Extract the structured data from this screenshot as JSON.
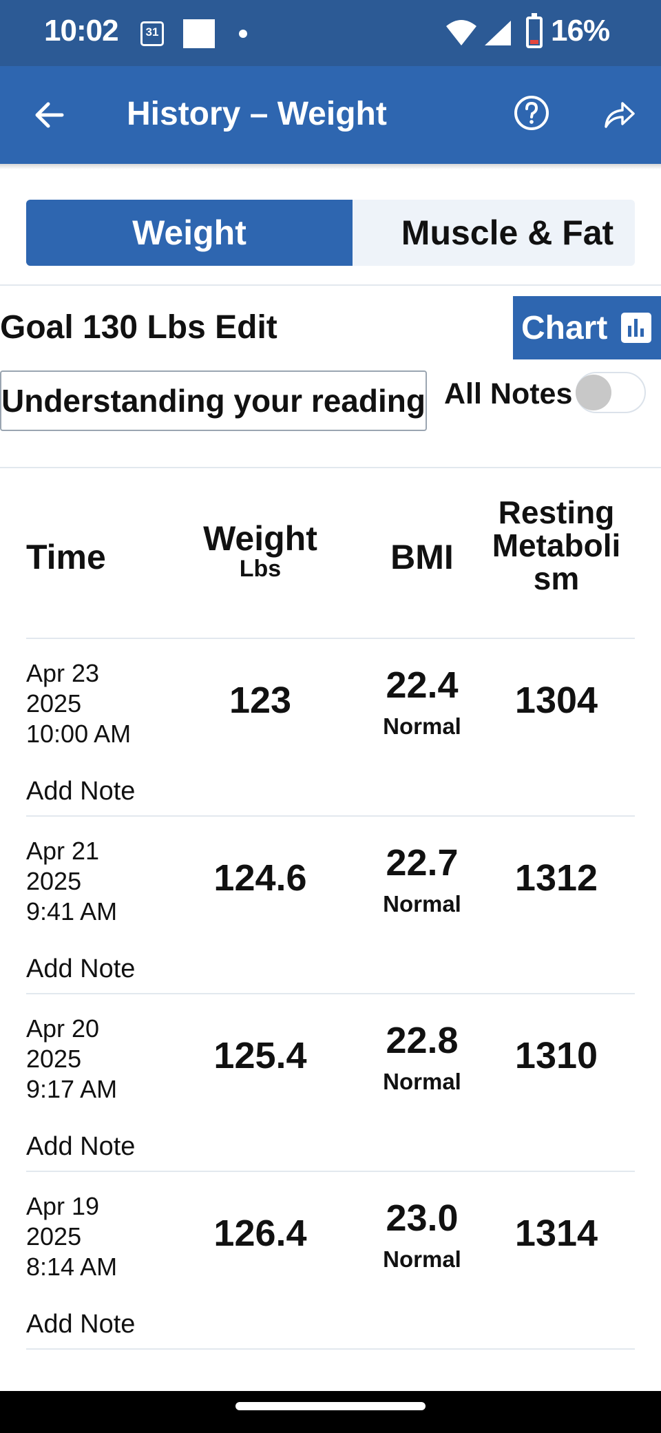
{
  "status_bar": {
    "time": "10:02",
    "calendar_day": "31",
    "battery_percent": "16%"
  },
  "app_bar": {
    "title": "History – Weight"
  },
  "tabs": [
    {
      "label": "Weight"
    },
    {
      "label": "Muscle & Fat"
    }
  ],
  "goal": {
    "text": "Goal 130 Lbs Edit"
  },
  "chart_button": {
    "label": "Chart"
  },
  "understanding_button": {
    "label": "Understanding your reading"
  },
  "notes_toggle": {
    "label": "All Notes",
    "on": false
  },
  "table": {
    "headers": {
      "time": "Time",
      "weight": "Weight",
      "weight_unit": "Lbs",
      "bmi": "BMI",
      "resting": "Resting Metaboli sm"
    },
    "rows": [
      {
        "date": "Apr 23",
        "year": "2025",
        "time": "10:00 AM",
        "weight": "123",
        "bmi": "22.4",
        "bmi_status": "Normal",
        "resting": "1304",
        "note": "Add Note"
      },
      {
        "date": "Apr 21",
        "year": "2025",
        "time": "9:41 AM",
        "weight": "124.6",
        "bmi": "22.7",
        "bmi_status": "Normal",
        "resting": "1312",
        "note": "Add Note"
      },
      {
        "date": "Apr 20",
        "year": "2025",
        "time": "9:17 AM",
        "weight": "125.4",
        "bmi": "22.8",
        "bmi_status": "Normal",
        "resting": "1310",
        "note": "Add Note"
      },
      {
        "date": "Apr 19",
        "year": "2025",
        "time": "8:14 AM",
        "weight": "126.4",
        "bmi": "23.0",
        "bmi_status": "Normal",
        "resting": "1314",
        "note": "Add Note"
      }
    ]
  },
  "colors": {
    "status_bar": "#2c5a95",
    "primary": "#2e66b0",
    "tab_inactive_bg": "#eef3f9",
    "divider": "#e2e8ee"
  }
}
